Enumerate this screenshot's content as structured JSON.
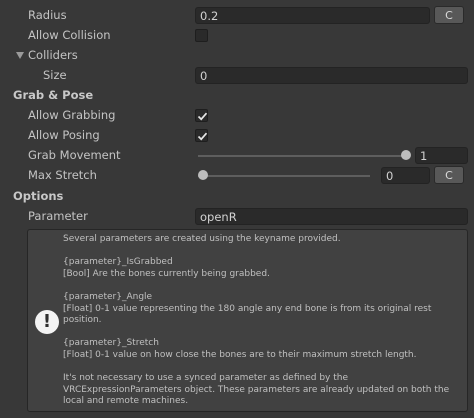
{
  "radius": {
    "label": "Radius",
    "value": "0.2",
    "button": "C"
  },
  "allow_collision": {
    "label": "Allow Collision",
    "checked": false
  },
  "colliders": {
    "label": "Colliders",
    "size_label": "Size",
    "size_value": "0"
  },
  "grab_pose": {
    "heading": "Grab & Pose",
    "allow_grabbing": {
      "label": "Allow Grabbing",
      "checked": true
    },
    "allow_posing": {
      "label": "Allow Posing",
      "checked": true
    },
    "grab_movement": {
      "label": "Grab Movement",
      "value": "1",
      "level": 1.0
    },
    "max_stretch": {
      "label": "Max Stretch",
      "value": "0",
      "level": 0.0,
      "button": "C"
    }
  },
  "options": {
    "heading": "Options",
    "parameter": {
      "label": "Parameter",
      "value": "openR"
    }
  },
  "help": {
    "icon": "info-icon",
    "lines": {
      "l1": "Several parameters are created using the keyname provided.",
      "l2": "{parameter}_IsGrabbed",
      "l3": " [Bool] Are the bones currently being grabbed.",
      "l4": "{parameter}_Angle",
      "l5": " [Float] 0-1 value representing the 180 angle any end bone is from its original rest position.",
      "l6": "{parameter}_Stretch",
      "l7": " [Float] 0-1 value on how close the bones are to their maximum stretch length.",
      "l8": "It's not necessary to use a synced parameter as defined by the VRCExpressionParameters object.  These parameters are already updated on both the local and remote machines."
    }
  }
}
